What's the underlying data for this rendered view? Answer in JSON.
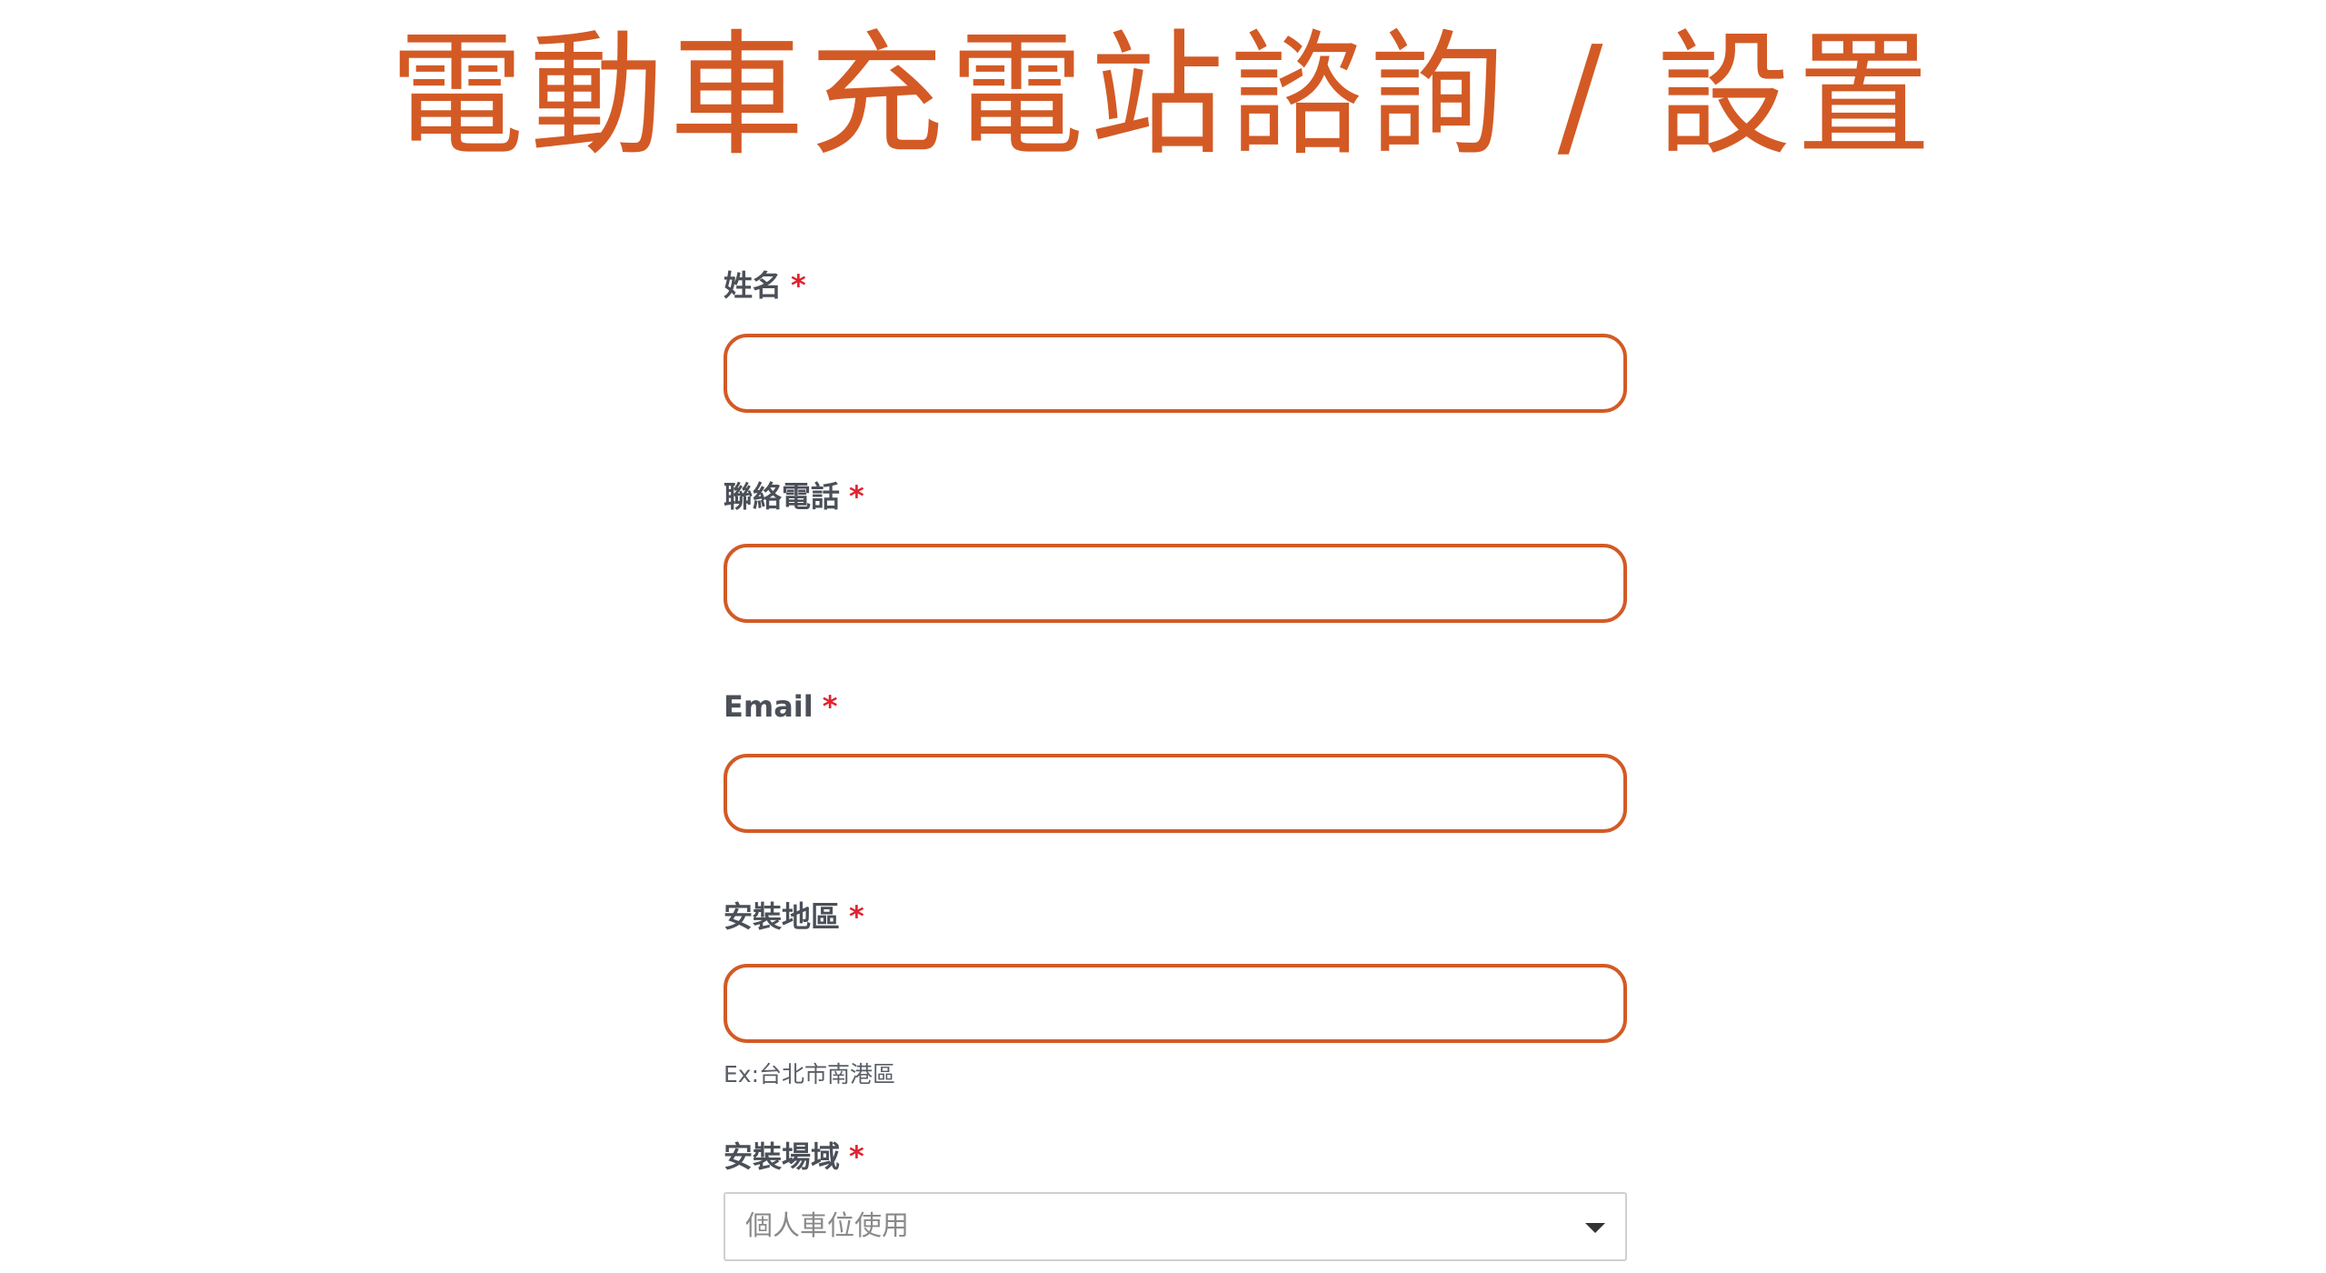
{
  "page": {
    "title": "電動車充電站諮詢 / 設置"
  },
  "form": {
    "name": {
      "label": "姓名",
      "required_mark": "*",
      "value": ""
    },
    "phone": {
      "label": "聯絡電話",
      "required_mark": "*",
      "value": ""
    },
    "email": {
      "label": "Email",
      "required_mark": "*",
      "value": ""
    },
    "region": {
      "label": "安裝地區",
      "required_mark": "*",
      "value": "",
      "hint": "Ex:台北市南港區"
    },
    "venue": {
      "label": "安裝場域",
      "required_mark": "*",
      "selected": "個人車位使用"
    }
  },
  "colors": {
    "accent": "#d35a25",
    "required": "#e0232e",
    "label_text": "#4b4f58"
  }
}
